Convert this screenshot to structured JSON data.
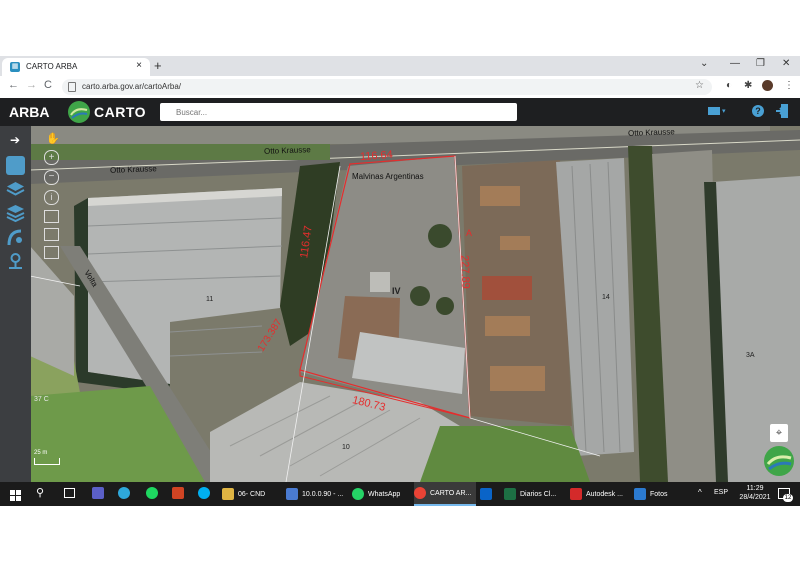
{
  "browser": {
    "tab_title": "CARTO ARBA",
    "tab_close": "×",
    "new_tab": "+",
    "url": "carto.arba.gov.ar/cartoArba/",
    "back": "←",
    "forward": "→",
    "reload": "C"
  },
  "app": {
    "brand": "ARBA",
    "product": "CARTO",
    "search_placeholder": "Buscar...",
    "help_label": "?"
  },
  "map": {
    "streets": [
      "Otto Krausse",
      "Otto Krausse",
      "Otto Krausse",
      "Malvinas Argentinas",
      "Volta"
    ],
    "dimensions": [
      "116.64",
      "116.47",
      "227.89",
      "180.73",
      "173.387"
    ],
    "block_labels": [
      "IV",
      "11",
      "14",
      "3A",
      "10",
      "A"
    ],
    "temperature": "37 C",
    "scale": "25 m"
  },
  "taskbar": {
    "items": [
      {
        "label": "06- CND",
        "color": "#e0b543"
      },
      {
        "label": "10.0.0.90 - ...",
        "color": "#4a7bd1"
      },
      {
        "label": "WhatsApp",
        "color": "#25d366"
      },
      {
        "label": "CARTO AR...",
        "color": "#ea4335"
      },
      {
        "label": "",
        "color": "#0a64c8"
      },
      {
        "label": "Diarios Cl...",
        "color": "#1d7044"
      },
      {
        "label": "Autodesk ...",
        "color": "#d42a2a"
      },
      {
        "label": "Fotos",
        "color": "#2b7ad0"
      }
    ],
    "lang": "ESP",
    "time": "11:29",
    "date": "28/4/2021",
    "notif_count": "12"
  }
}
